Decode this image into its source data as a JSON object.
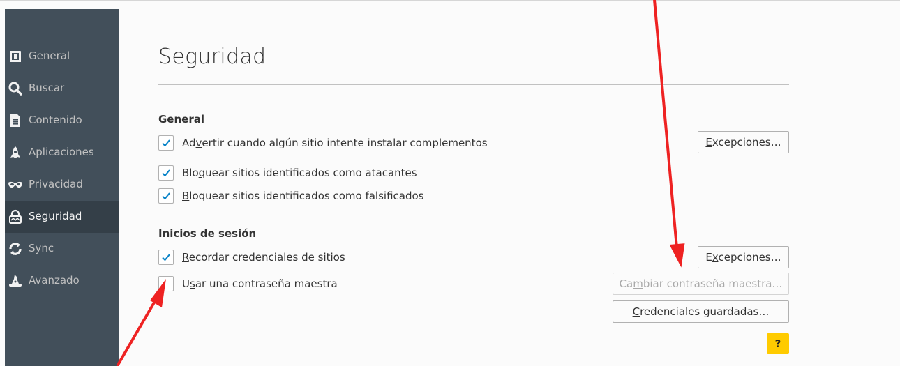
{
  "sidebar": {
    "items": [
      {
        "label": "General",
        "icon": "general-icon"
      },
      {
        "label": "Buscar",
        "icon": "search-icon"
      },
      {
        "label": "Contenido",
        "icon": "document-icon"
      },
      {
        "label": "Aplicaciones",
        "icon": "rocket-icon"
      },
      {
        "label": "Privacidad",
        "icon": "mask-icon"
      },
      {
        "label": "Seguridad",
        "icon": "lock-icon",
        "active": true
      },
      {
        "label": "Sync",
        "icon": "sync-icon"
      },
      {
        "label": "Avanzado",
        "icon": "wizard-hat-icon"
      }
    ]
  },
  "main": {
    "title": "Seguridad",
    "general": {
      "heading": "General",
      "warn_addons": {
        "pre": "Ad",
        "u": "v",
        "post": "ertir cuando algún sitio intente instalar complementos",
        "checked": true
      },
      "exceptions_1": {
        "pre": "",
        "u": "E",
        "post": "xcepciones…"
      },
      "block_attack": {
        "pre": "Blo",
        "u": "q",
        "post": "uear sitios identificados como atacantes",
        "checked": true
      },
      "block_forgery": {
        "pre": "",
        "u": "B",
        "post": "loquear sitios identificados como falsificados",
        "checked": true
      }
    },
    "logins": {
      "heading": "Inicios de sesión",
      "remember": {
        "pre": "",
        "u": "R",
        "post": "ecordar credenciales de sitios",
        "checked": true
      },
      "exceptions_2": {
        "pre": "E",
        "u": "x",
        "post": "cepciones…"
      },
      "master_password": {
        "pre": "U",
        "u": "s",
        "post": "ar una contraseña maestra",
        "checked": false
      },
      "change_master": {
        "pre": "Ca",
        "u": "m",
        "post": "biar contraseña maestra…"
      },
      "saved_logins": {
        "pre": "",
        "u": "C",
        "post": "redenciales guardadas…"
      }
    },
    "help": "?"
  },
  "colors": {
    "sidebar_bg": "#424f5a",
    "sidebar_active": "#343f48",
    "checkmark": "#0a84c8",
    "help_bg": "#ffcb00",
    "annotation_arrow": "#ee2222"
  }
}
